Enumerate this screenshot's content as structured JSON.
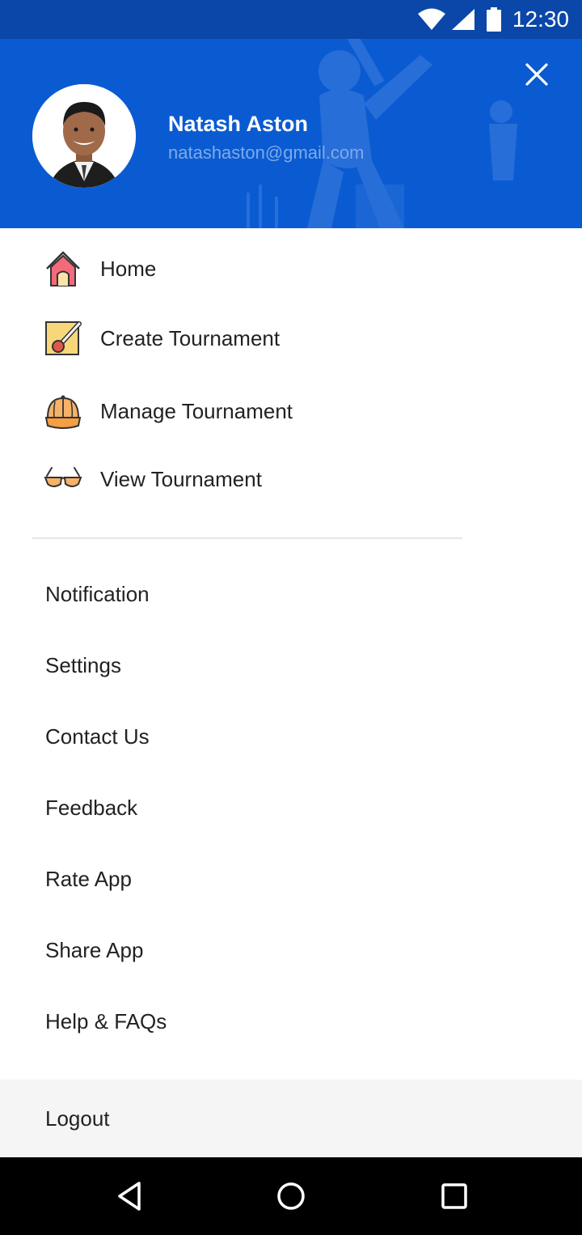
{
  "status_bar": {
    "time": "12:30",
    "icons": [
      "wifi-icon",
      "signal-icon",
      "battery-icon"
    ]
  },
  "header": {
    "user_name": "Natash Aston",
    "user_email": "natashaston@gmail.com",
    "close_icon": "close-icon",
    "background_color": "#0a5bd1"
  },
  "menu_primary": [
    {
      "label": "Home",
      "icon": "home-icon"
    },
    {
      "label": "Create Tournament",
      "icon": "create-tournament-icon"
    },
    {
      "label": "Manage Tournament",
      "icon": "cap-icon"
    },
    {
      "label": "View Tournament",
      "icon": "glasses-icon"
    }
  ],
  "menu_secondary": [
    {
      "label": "Notification"
    },
    {
      "label": "Settings"
    },
    {
      "label": "Contact Us"
    },
    {
      "label": "Feedback"
    },
    {
      "label": "Rate App"
    },
    {
      "label": "Share App"
    },
    {
      "label": "Help & FAQs"
    }
  ],
  "logout": {
    "label": "Logout"
  },
  "nav_bar": {
    "icons": [
      "back-icon",
      "home-nav-icon",
      "recents-icon"
    ]
  }
}
